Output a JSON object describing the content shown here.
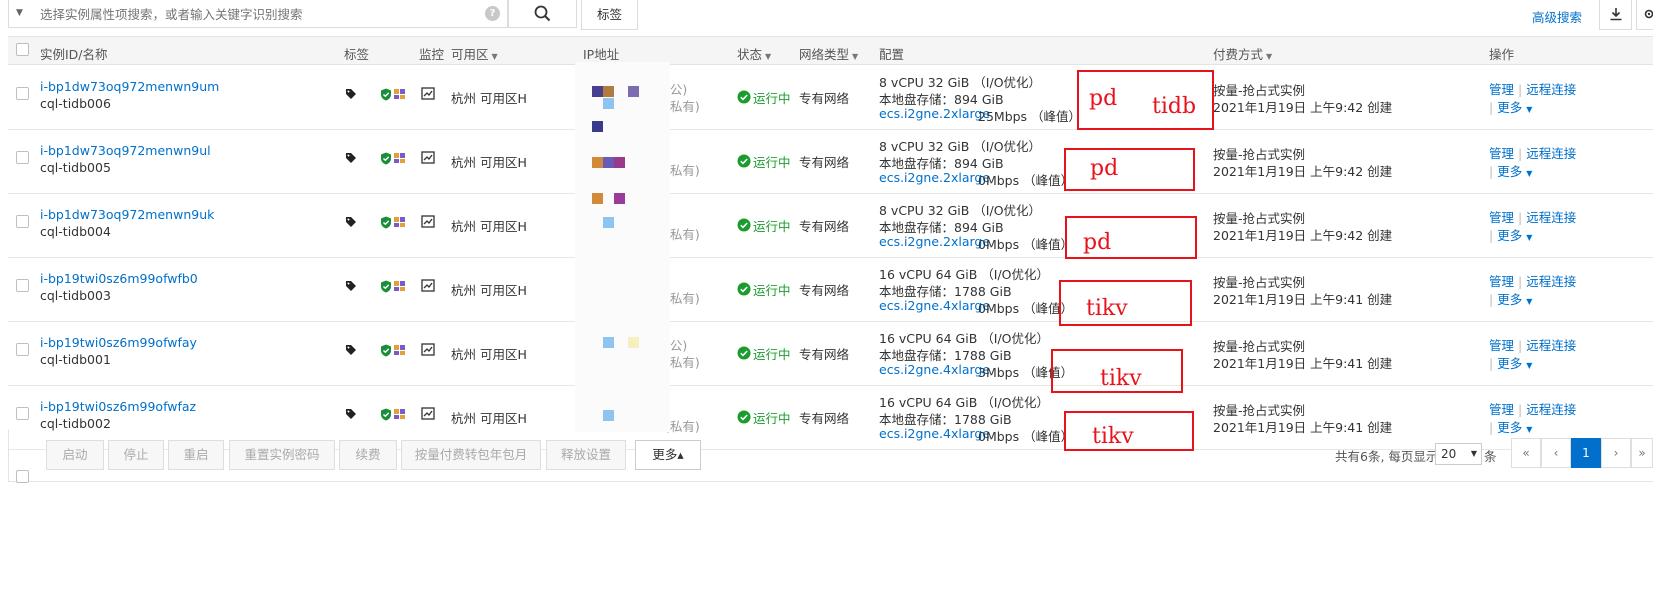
{
  "search": {
    "placeholder": "选择实例属性项搜索，或者输入关键字识别搜索",
    "help_label": "?",
    "tag_button": "标签",
    "advanced_search": "高级搜索"
  },
  "columns": {
    "instance": "实例ID/名称",
    "tags": "标签",
    "monitor": "监控",
    "zone": "可用区",
    "ip": "IP地址",
    "status": "状态",
    "network": "网络类型",
    "config": "配置",
    "billing": "付费方式",
    "actions": "操作"
  },
  "rows": [
    {
      "id": "i-bp1dw73oq972menwn9um",
      "name": "cql-tidb006",
      "zone": "杭州 可用区H",
      "ip_public": "(公)",
      "ip_private": "(私有)",
      "status": "运行中",
      "network": "专有网络",
      "cpu": "8 vCPU 32 GiB （I/O优化）",
      "disk": "本地盘存储：894 GiB",
      "spec": "ecs.i2gne.2xlarge",
      "bandwidth": "25Mbps （峰值）",
      "billing": "按量-抢占式实例",
      "created": "2021年1月19日 上午9:42 创建",
      "manage": "管理",
      "remote": "远程连接",
      "more": "更多",
      "annot1": "pd",
      "annot2": "tidb"
    },
    {
      "id": "i-bp1dw73oq972menwn9ul",
      "name": "cql-tidb005",
      "zone": "杭州 可用区H",
      "ip_public": "",
      "ip_private": "(私有)",
      "status": "运行中",
      "network": "专有网络",
      "cpu": "8 vCPU 32 GiB （I/O优化）",
      "disk": "本地盘存储：894 GiB",
      "spec": "ecs.i2gne.2xlarge",
      "bandwidth": "0Mbps （峰值）",
      "billing": "按量-抢占式实例",
      "created": "2021年1月19日 上午9:42 创建",
      "manage": "管理",
      "remote": "远程连接",
      "more": "更多",
      "annot1": "pd",
      "annot2": ""
    },
    {
      "id": "i-bp1dw73oq972menwn9uk",
      "name": "cql-tidb004",
      "zone": "杭州 可用区H",
      "ip_public": "",
      "ip_private": "(私有)",
      "status": "运行中",
      "network": "专有网络",
      "cpu": "8 vCPU 32 GiB （I/O优化）",
      "disk": "本地盘存储：894 GiB",
      "spec": "ecs.i2gne.2xlarge",
      "bandwidth": "0Mbps （峰值）",
      "billing": "按量-抢占式实例",
      "created": "2021年1月19日 上午9:42 创建",
      "manage": "管理",
      "remote": "远程连接",
      "more": "更多",
      "annot1": "pd",
      "annot2": ""
    },
    {
      "id": "i-bp19twi0sz6m99ofwfb0",
      "name": "cql-tidb003",
      "zone": "杭州 可用区H",
      "ip_public": "",
      "ip_private": "(私有)",
      "status": "运行中",
      "network": "专有网络",
      "cpu": "16 vCPU 64 GiB （I/O优化）",
      "disk": "本地盘存储：1788 GiB",
      "spec": "ecs.i2gne.4xlarge",
      "bandwidth": "0Mbps （峰值）",
      "billing": "按量-抢占式实例",
      "created": "2021年1月19日 上午9:41 创建",
      "manage": "管理",
      "remote": "远程连接",
      "more": "更多",
      "annot1": "tikv",
      "annot2": ""
    },
    {
      "id": "i-bp19twi0sz6m99ofwfay",
      "name": "cql-tidb001",
      "zone": "杭州 可用区H",
      "ip_public": "(公)",
      "ip_private": "(私有)",
      "status": "运行中",
      "network": "专有网络",
      "cpu": "16 vCPU 64 GiB （I/O优化）",
      "disk": "本地盘存储：1788 GiB",
      "spec": "ecs.i2gne.4xlarge",
      "bandwidth": "3Mbps （峰值）",
      "billing": "按量-抢占式实例",
      "created": "2021年1月19日 上午9:41 创建",
      "manage": "管理",
      "remote": "远程连接",
      "more": "更多",
      "annot1": "tikv",
      "annot2": ""
    },
    {
      "id": "i-bp19twi0sz6m99ofwfaz",
      "name": "cql-tidb002",
      "zone": "杭州 可用区H",
      "ip_public": "",
      "ip_private": "(私有)",
      "status": "运行中",
      "network": "专有网络",
      "cpu": "16 vCPU 64 GiB （I/O优化）",
      "disk": "本地盘存储：1788 GiB",
      "spec": "ecs.i2gne.4xlarge",
      "bandwidth": "0Mbps （峰值）",
      "billing": "按量-抢占式实例",
      "created": "2021年1月19日 上午9:41 创建",
      "manage": "管理",
      "remote": "远程连接",
      "more": "更多",
      "annot1": "tikv",
      "annot2": ""
    }
  ],
  "footer": {
    "buttons": [
      "启动",
      "停止",
      "重启",
      "重置实例密码",
      "续费",
      "按量付费转包年包月",
      "释放设置",
      "更多▴"
    ],
    "total_info": "共有6条, 每页显示：",
    "page_size": "20",
    "page_unit": "条",
    "pager": [
      "«",
      "‹",
      "1",
      "›",
      "»"
    ]
  },
  "colors": {
    "accent": "#0070cc",
    "status_green": "#1a9c2f",
    "annotation_red": "#e8121b"
  },
  "icons": [
    "search-icon",
    "download-icon",
    "settings-icon",
    "tag-icon",
    "shield-icon",
    "puzzle-icon",
    "monitor-chart-icon",
    "check-circle-icon"
  ]
}
